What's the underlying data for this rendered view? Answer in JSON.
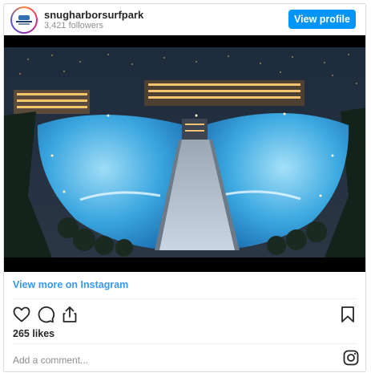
{
  "header": {
    "username": "snugharborsurfpark",
    "followers": "3,421 followers",
    "view_profile_label": "View profile"
  },
  "post": {
    "view_more_label": "View more on Instagram",
    "likes": "265 likes",
    "comment_placeholder": "Add a comment..."
  },
  "icons": {
    "like": "heart-icon",
    "comment": "comment-icon",
    "share": "share-icon",
    "save": "bookmark-icon",
    "brand": "instagram-icon"
  },
  "colors": {
    "accent": "#0095f6",
    "link": "#3897f0",
    "muted": "#8e8e8e"
  }
}
